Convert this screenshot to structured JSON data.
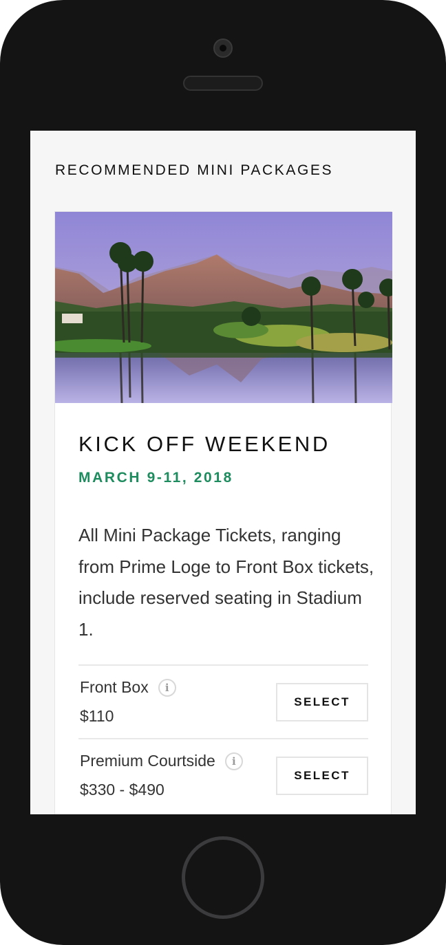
{
  "section": {
    "title": "RECOMMENDED MINI PACKAGES"
  },
  "package": {
    "image_alt": "desert-mountain-golf-course-photo",
    "title": "KICK OFF WEEKEND",
    "date": "MARCH 9-11, 2018",
    "description": "All Mini Package Tickets, ranging from Prime Loge to Front Box tickets, include reserved seating in Stadium 1.",
    "tiers": [
      {
        "name": "Front Box",
        "price": "$110",
        "info_icon": "info-icon",
        "button_label": "SELECT"
      },
      {
        "name": "Premium Courtside",
        "price": "$330 - $490",
        "info_icon": "info-icon",
        "button_label": "SELECT"
      }
    ]
  },
  "colors": {
    "accent_green": "#1e8c5e",
    "device_body": "#141414",
    "screen_bg": "#f6f6f6"
  }
}
